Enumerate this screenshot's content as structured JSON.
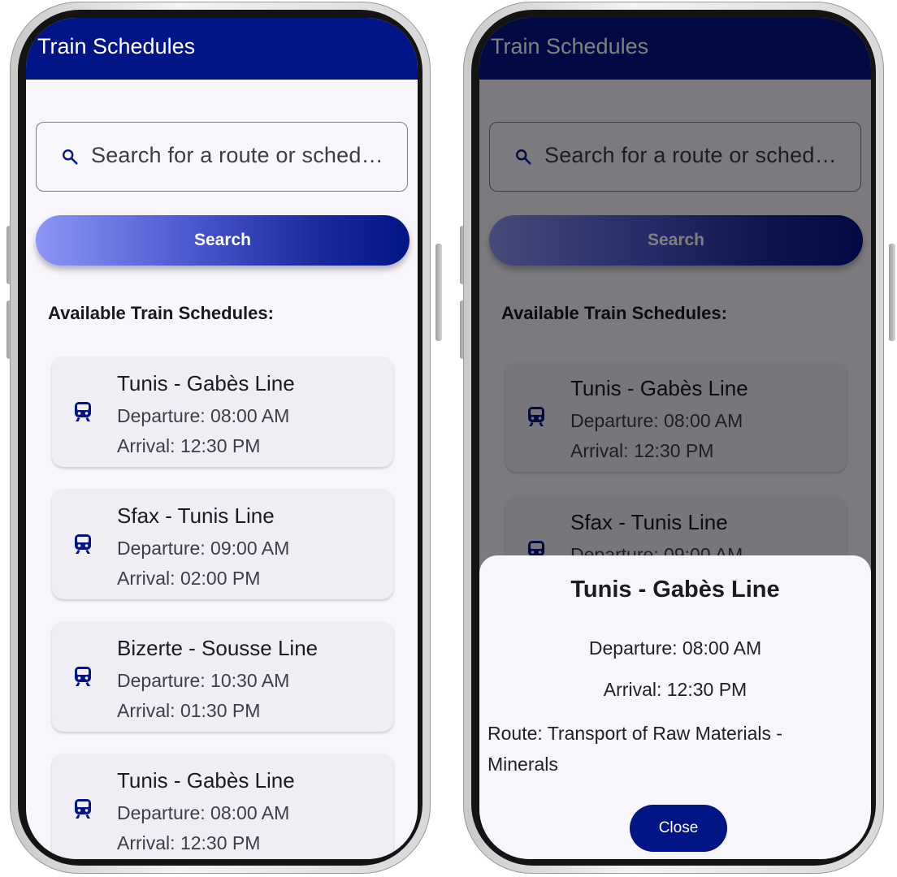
{
  "screen_list": {
    "app_title": "Train Schedules",
    "search": {
      "placeholder": "Search for a route or sched…"
    },
    "search_button": "Search",
    "section_title": "Available Train Schedules:",
    "schedules": [
      {
        "route": "Tunis - Gabès Line",
        "departure": "Departure: 08:00 AM",
        "arrival": "Arrival: 12:30 PM"
      },
      {
        "route": "Sfax - Tunis Line",
        "departure": "Departure: 09:00 AM",
        "arrival": "Arrival: 02:00 PM"
      },
      {
        "route": "Bizerte - Sousse Line",
        "departure": "Departure: 10:30 AM",
        "arrival": "Arrival: 01:30 PM"
      },
      {
        "route": "Tunis - Gabès Line",
        "departure": "Departure: 08:00 AM",
        "arrival": "Arrival: 12:30 PM"
      }
    ]
  },
  "screen_detail": {
    "app_title": "Train Schedules",
    "search": {
      "placeholder": "Search for a route or sched…"
    },
    "search_button": "Search",
    "section_title": "Available Train Schedules:",
    "schedules": [
      {
        "route": "Tunis - Gabès Line",
        "departure": "Departure: 08:00 AM",
        "arrival": "Arrival: 12:30 PM"
      },
      {
        "route": "Sfax - Tunis Line",
        "departure": "Departure: 09:00 AM"
      }
    ],
    "sheet": {
      "title": "Tunis - Gabès Line",
      "departure": "Departure: 08:00 AM",
      "arrival": "Arrival: 12:30 PM",
      "route": "Route: Transport of Raw Materials - Minerals",
      "close_label": "Close"
    }
  },
  "icons": {
    "search": "search-icon",
    "train": "train-icon"
  },
  "colors": {
    "primary": "#021586",
    "gradient_start": "#8c96f6",
    "background": "#f8f5fc",
    "card": "#f1edf5"
  }
}
